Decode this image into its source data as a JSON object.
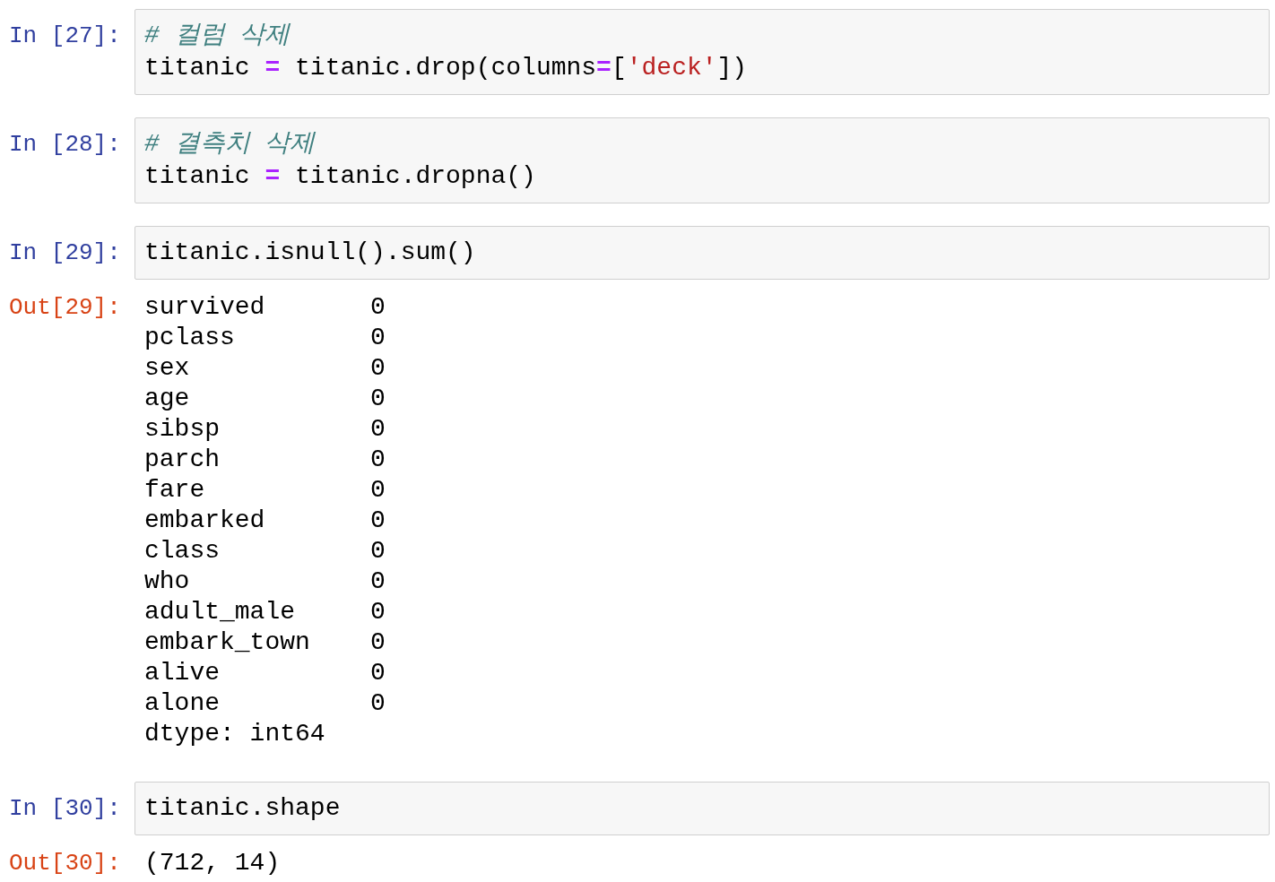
{
  "cells": [
    {
      "input": {
        "prompt": "In [27]:",
        "lines": [
          [
            {
              "kind": "comment",
              "text": "# 컬럼 삭제"
            }
          ],
          [
            {
              "kind": "name",
              "text": "titanic "
            },
            {
              "kind": "operator",
              "text": "="
            },
            {
              "kind": "name",
              "text": " titanic.drop(columns"
            },
            {
              "kind": "operator",
              "text": "="
            },
            {
              "kind": "name",
              "text": "["
            },
            {
              "kind": "string",
              "text": "'deck'"
            },
            {
              "kind": "name",
              "text": "])"
            }
          ]
        ]
      }
    },
    {
      "input": {
        "prompt": "In [28]:",
        "lines": [
          [
            {
              "kind": "comment",
              "text": "# 결측치 삭제"
            }
          ],
          [
            {
              "kind": "name",
              "text": "titanic "
            },
            {
              "kind": "operator",
              "text": "="
            },
            {
              "kind": "name",
              "text": " titanic.dropna()"
            }
          ]
        ]
      }
    },
    {
      "input": {
        "prompt": "In [29]:",
        "lines": [
          [
            {
              "kind": "name",
              "text": "titanic.isnull().sum()"
            }
          ]
        ]
      },
      "output": {
        "prompt": "Out[29]:",
        "lines": [
          "survived       0",
          "pclass         0",
          "sex            0",
          "age            0",
          "sibsp          0",
          "parch          0",
          "fare           0",
          "embarked       0",
          "class          0",
          "who            0",
          "adult_male     0",
          "embark_town    0",
          "alive          0",
          "alone          0",
          "dtype: int64"
        ]
      }
    },
    {
      "input": {
        "prompt": "In [30]:",
        "lines": [
          [
            {
              "kind": "name",
              "text": "titanic.shape"
            }
          ]
        ]
      },
      "output": {
        "prompt": "Out[30]:",
        "lines": [
          "(712, 14)"
        ]
      }
    }
  ]
}
